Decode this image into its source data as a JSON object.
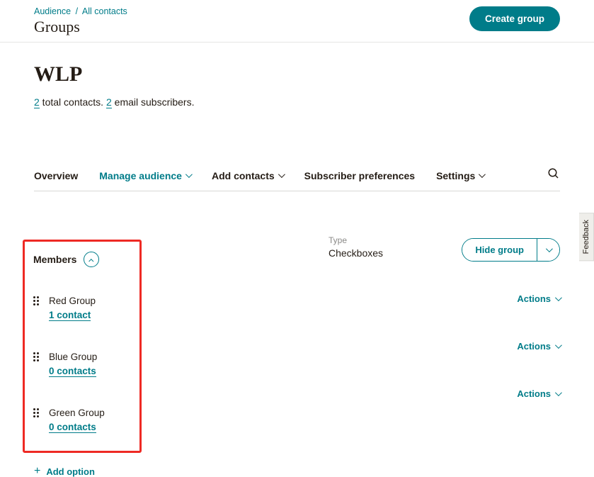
{
  "breadcrumb": {
    "root": "Audience",
    "leaf": "All contacts"
  },
  "page_title": "Groups",
  "create_button": "Create group",
  "audience_name": "WLP",
  "stats": {
    "total_count": "2",
    "total_label": " total contacts. ",
    "email_count": "2",
    "email_label": " email subscribers."
  },
  "nav": {
    "overview": "Overview",
    "manage": "Manage audience",
    "add": "Add contacts",
    "prefs": "Subscriber preferences",
    "settings": "Settings"
  },
  "feedback": "Feedback",
  "members": {
    "header": "Members",
    "type_label": "Type",
    "type_value": "Checkboxes",
    "hide_button": "Hide group",
    "action_label": "Actions",
    "add_option": "Add option",
    "groups": [
      {
        "name": "Red Group",
        "count": "1 contact"
      },
      {
        "name": "Blue Group",
        "count": "0 contacts"
      },
      {
        "name": "Green Group",
        "count": "0 contacts"
      }
    ]
  }
}
